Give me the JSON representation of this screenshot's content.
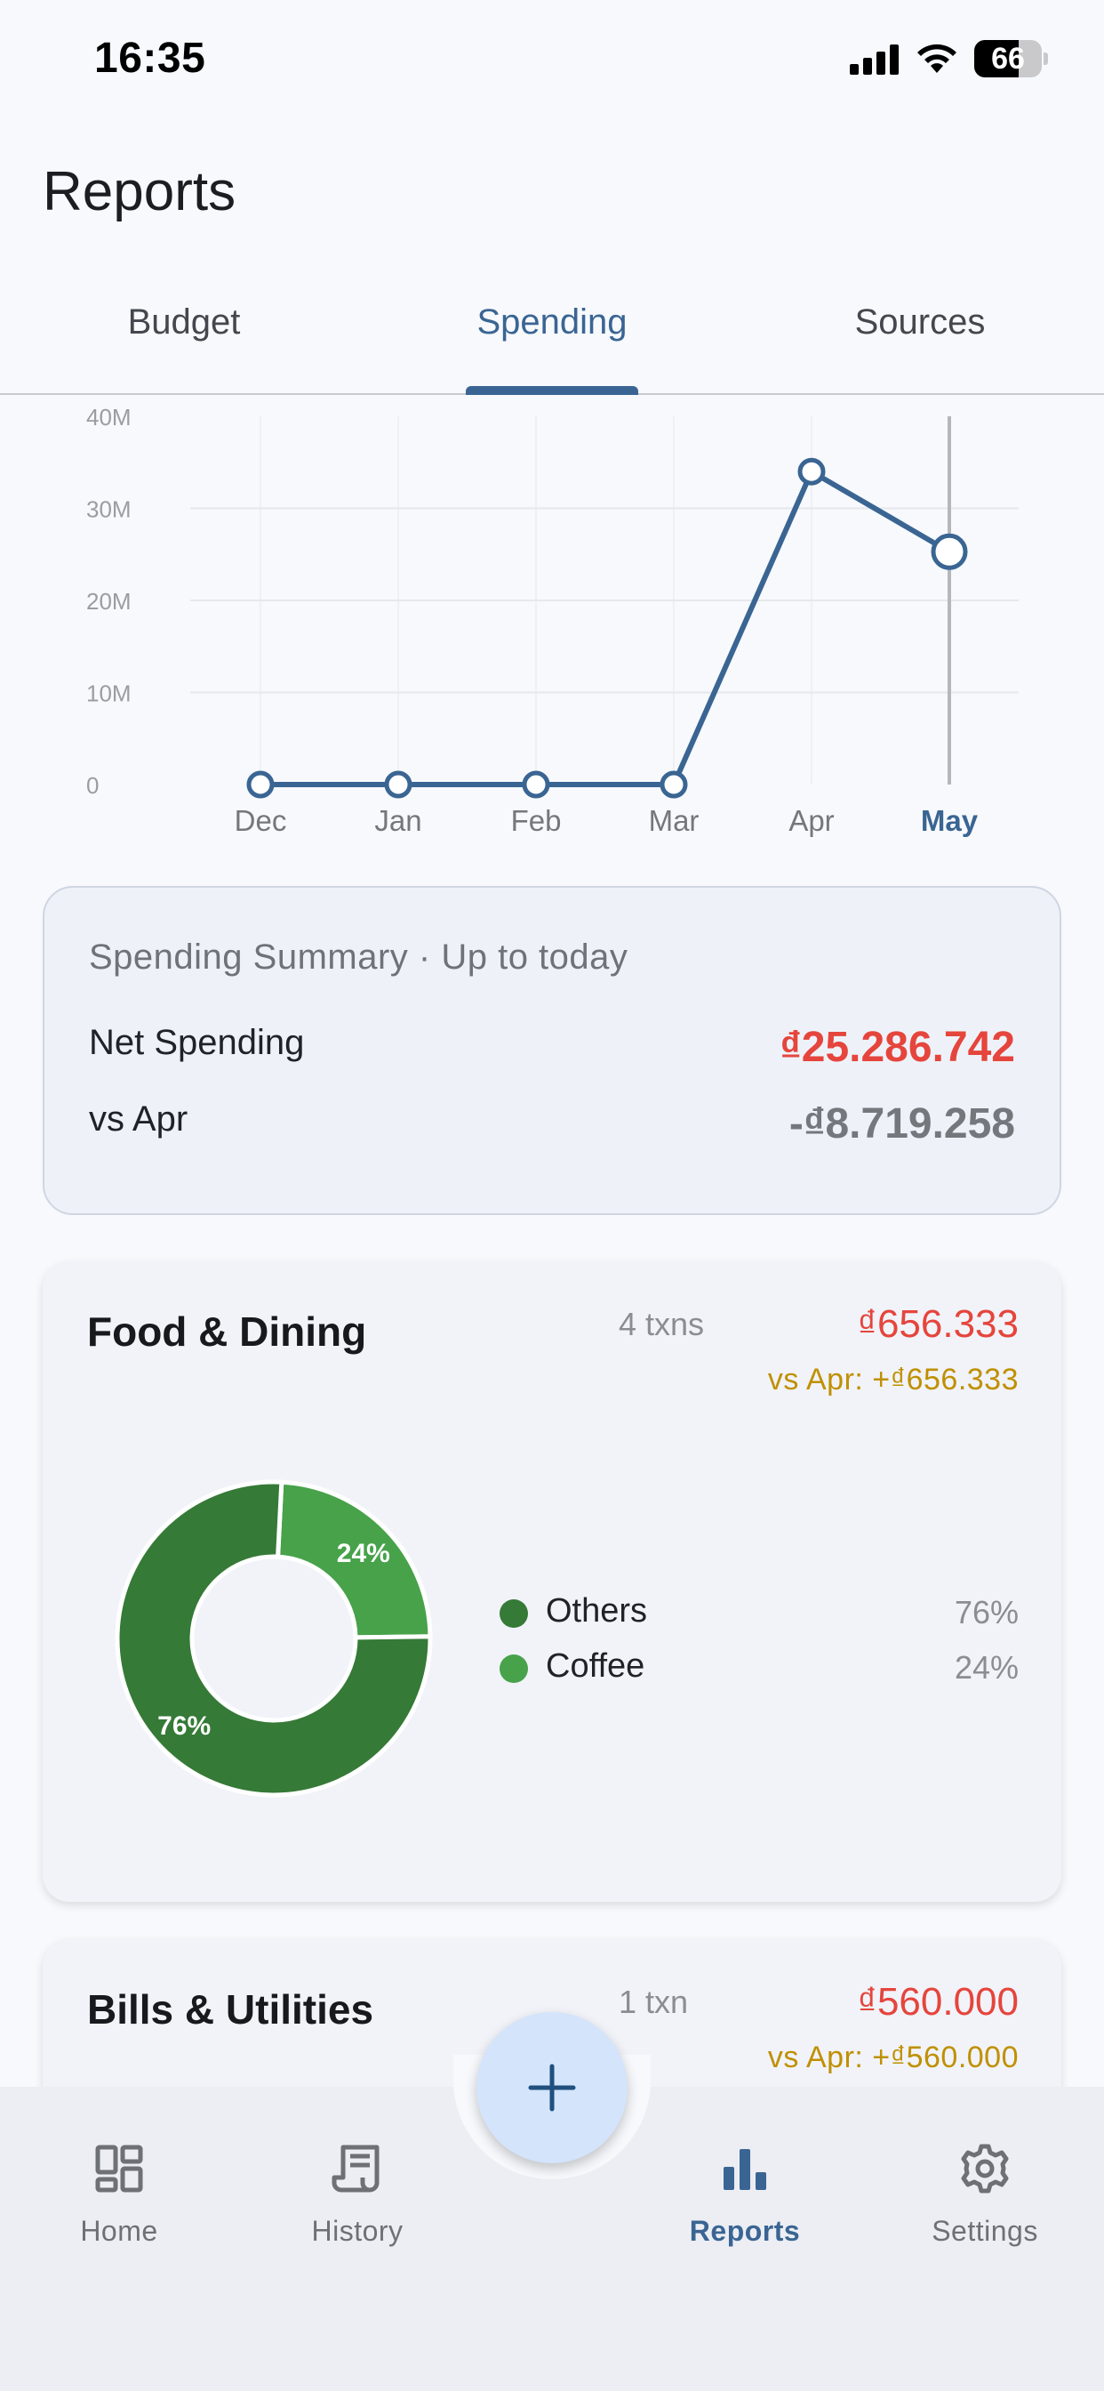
{
  "status_bar": {
    "time": "16:35",
    "battery": "66",
    "battery_level": 0.66
  },
  "header": {
    "title": "Reports"
  },
  "tabs": [
    {
      "label": "Budget",
      "active": false
    },
    {
      "label": "Spending",
      "active": true
    },
    {
      "label": "Sources",
      "active": false
    }
  ],
  "chart_data": {
    "type": "line",
    "categories": [
      "Dec",
      "Jan",
      "Feb",
      "Mar",
      "Apr",
      "May"
    ],
    "values": [
      0,
      0,
      0,
      0,
      33990000,
      25286742
    ],
    "y_tick_labels": [
      "0",
      "10M",
      "20M",
      "30M",
      "40M"
    ],
    "ylim": [
      0,
      40000000
    ],
    "selected_category": "May",
    "grid": true,
    "line_color": "#3a6593"
  },
  "summary": {
    "title": "Spending Summary · Up to today",
    "net_label": "Net Spending",
    "net_value": "₫25.286.742",
    "vs_label": "vs Apr",
    "vs_value": "-₫8.719.258"
  },
  "categories": [
    {
      "name": "Food & Dining",
      "txn_count": "4 txns",
      "amount": "₫656.333",
      "vs": "vs Apr: +₫656.333",
      "breakdown": [
        {
          "label": "Others",
          "percent_label": "76%",
          "percent": 76,
          "color": "#357a37"
        },
        {
          "label": "Coffee",
          "percent_label": "24%",
          "percent": 24,
          "color": "#47a24a"
        }
      ]
    },
    {
      "name": "Bills & Utilities",
      "txn_count": "1 txn",
      "amount": "₫560.000",
      "vs": "vs Apr: +₫560.000"
    }
  ],
  "fab": {
    "icon": "plus-icon"
  },
  "bottom_nav": [
    {
      "label": "Home",
      "icon": "dashboard-icon",
      "active": false
    },
    {
      "label": "History",
      "icon": "receipt-icon",
      "active": false
    },
    {
      "label": "Reports",
      "icon": "bar-chart-icon",
      "active": true
    },
    {
      "label": "Settings",
      "icon": "gear-icon",
      "active": false
    }
  ],
  "colors": {
    "accent": "#3a6593",
    "negative": "#e5453c",
    "delta": "#c09000"
  }
}
